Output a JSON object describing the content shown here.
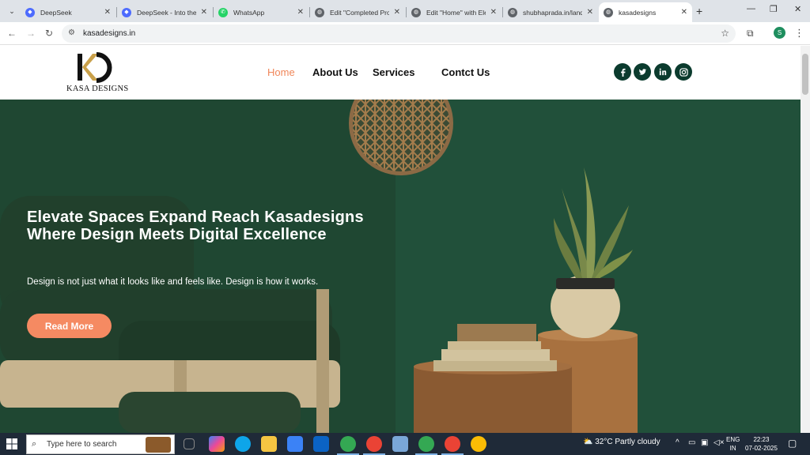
{
  "browser": {
    "tabs": [
      {
        "title": "DeepSeek",
        "icon": "deepseek-icon"
      },
      {
        "title": "DeepSeek - Into the",
        "icon": "deepseek-icon"
      },
      {
        "title": "WhatsApp",
        "icon": "whatsapp-icon"
      },
      {
        "title": "Edit \"Completed Pro",
        "icon": "globe-icon"
      },
      {
        "title": "Edit \"Home\" with Ele",
        "icon": "globe-icon"
      },
      {
        "title": "shubhaprada.in/land",
        "icon": "globe-icon"
      },
      {
        "title": "kasadesigns",
        "icon": "globe-icon"
      }
    ],
    "active_tab": 6,
    "url": "kasadesigns.in",
    "profile_initial": "S"
  },
  "site": {
    "logo_text": "KASA DESIGNS",
    "nav": [
      {
        "label": "Home",
        "active": true
      },
      {
        "label": "About Us",
        "active": false
      },
      {
        "label": "Services",
        "active": false
      },
      {
        "label": "Contct Us",
        "active": false
      }
    ],
    "social": [
      "facebook-icon",
      "twitter-icon",
      "linkedin-icon",
      "instagram-icon"
    ],
    "hero": {
      "title": "Elevate Spaces Expand Reach Kasadesigns Where Design Meets Digital Excellence",
      "subtitle": "Design is not just what it looks like and feels like. Design is how it works.",
      "button": "Read More"
    },
    "colors": {
      "accent": "#f0875a",
      "button": "#f58a62",
      "hero_bg": "#1f4a34",
      "social_bg": "#0b3b2e"
    }
  },
  "taskbar": {
    "search_placeholder": "Type here to search",
    "weather": "32°C  Partly cloudy",
    "lang_1": "ENG",
    "lang_2": "IN",
    "time": "22:23",
    "date": "07-02-2025"
  }
}
